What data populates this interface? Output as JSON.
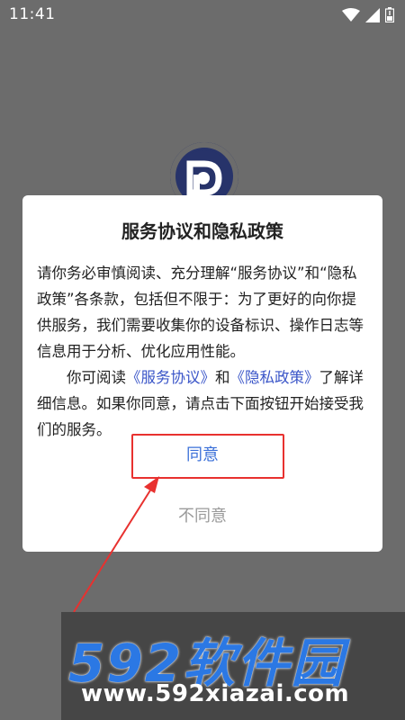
{
  "status_bar": {
    "time": "11:41",
    "icons": [
      "wifi-icon",
      "signal-icon",
      "battery-icon"
    ]
  },
  "background": {
    "logo_icon": "app-logo-icon"
  },
  "dialog": {
    "title": "服务协议和隐私政策",
    "paragraph1": "请你务必审慎阅读、充分理解“服务协议”和“隐私政策”各条款，包括但不限于：为了更好的向你提供服务，我们需要收集你的设备标识、操作日志等信息用于分析、优化应用性能。",
    "paragraph2_pre": "你可阅读",
    "service_link": "《服务协议》",
    "paragraph2_and": "和",
    "privacy_link": "《隐私政策》",
    "paragraph2_post": "了解详细信息。如果你同意，请点击下面按钮开始接受我们的服务。",
    "agree_label": "同意",
    "disagree_label": "不同意"
  },
  "watermark": {
    "logo_text": "592软件园",
    "url": "www.592xiazai.com"
  },
  "colors": {
    "overlay": "#6c6c6c",
    "link": "#3a55c8",
    "agree": "#3a6fd8",
    "disagree": "#9a9a9a",
    "highlight": "#e8312f",
    "watermark_brand": "#2b78e4"
  }
}
